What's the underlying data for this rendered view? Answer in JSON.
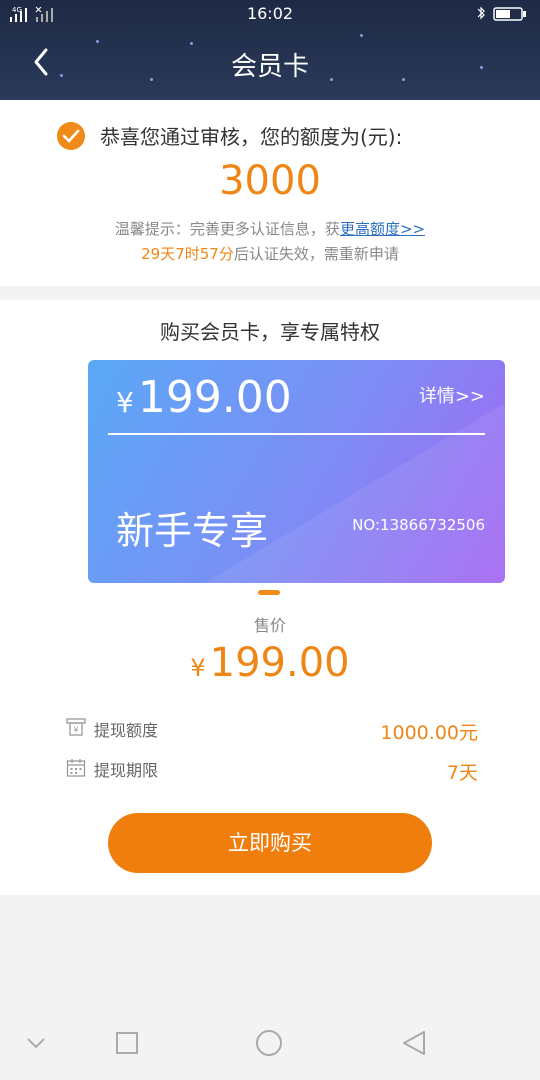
{
  "status": {
    "time": "16:02",
    "signal_label": "4G"
  },
  "header": {
    "title": "会员卡"
  },
  "approval": {
    "congrats": "恭喜您通过审核，您的额度为(元):",
    "amount": "3000",
    "tip_prefix": "温馨提示：完善更多认证信息，获",
    "tip_link": "更高额度>>",
    "expire_highlight": "29天7时57分",
    "expire_suffix": "后认证失效，需重新申请"
  },
  "card_section": {
    "title": "购买会员卡，享专属特权",
    "card": {
      "currency": "¥",
      "price": "199.00",
      "detail": "详情>>",
      "name": "新手专享",
      "number": "NO:13866732506"
    },
    "sale_label": "售价",
    "sale_currency": "¥",
    "sale_price": "199.00",
    "rows": [
      {
        "icon": "withdraw-amount-icon",
        "label": "提现额度",
        "value": "1000.00元"
      },
      {
        "icon": "calendar-icon",
        "label": "提现期限",
        "value": "7天"
      }
    ],
    "buy_button": "立即购买"
  },
  "colors": {
    "accent": "#ee8616",
    "header_bg": "#1e2a45",
    "link": "#2c6fc2"
  }
}
